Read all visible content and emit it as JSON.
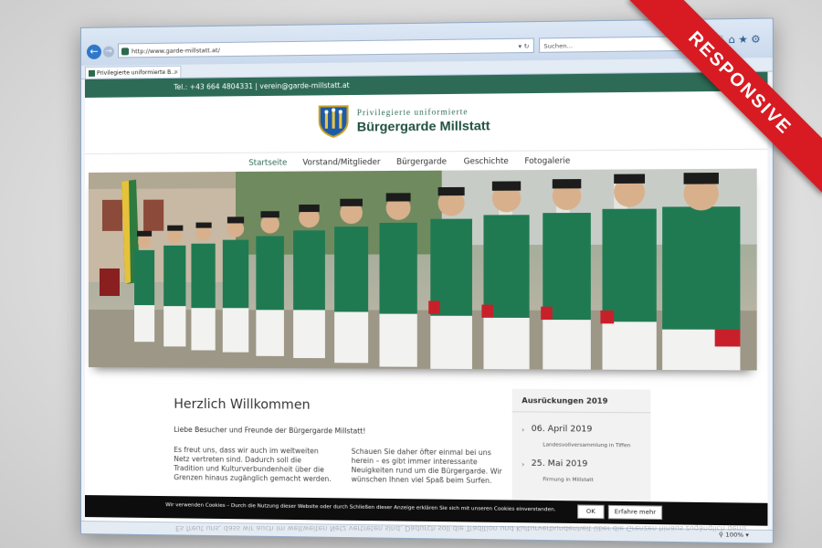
{
  "browser": {
    "url": "http://www.garde-millstatt.at/",
    "search_placeholder": "Suchen...",
    "tab_title": "Privilegierte uniformierte B...",
    "zoom": "100%"
  },
  "site": {
    "contact": "Tel.: +43 664 4804331 | verein@garde-millstatt.at",
    "logo_line1": "Privilegierte uniformierte",
    "logo_line2": "Bürgergarde Millstatt"
  },
  "menu": [
    {
      "label": "Startseite",
      "active": true
    },
    {
      "label": "Vorstand/Mitglieder"
    },
    {
      "label": "Bürgergarde"
    },
    {
      "label": "Geschichte"
    },
    {
      "label": "Fotogalerie"
    }
  ],
  "welcome": {
    "title": "Herzlich Willkommen",
    "intro": "Liebe Besucher und Freunde der Bürgergarde Millstatt!",
    "col1": "Es freut uns, dass wir auch im weltweiten Netz vertreten sind. Dadurch soll die Tradition und Kulturverbundenheit über die Grenzen hinaus zugänglich gemacht werden.",
    "col2": "Schauen Sie daher öfter einmal bei uns herein – es gibt immer interessante Neuigkeiten rund um die Bürgergarde. Wir wünschen Ihnen viel Spaß beim Surfen."
  },
  "sidebar": {
    "heading": "Ausrückungen 2019",
    "events": [
      {
        "date": "06. April 2019",
        "desc": "Landesvollversammlung in Tiffen"
      },
      {
        "date": "25. Mai 2019",
        "desc": "Firmung in Millstatt"
      }
    ]
  },
  "cookie": {
    "text": "Wir verwenden Cookies – Durch die Nutzung dieser Website oder durch Schließen dieser Anzeige erklären Sie sich mit unseren Cookies einverstanden.",
    "ok": "OK",
    "more": "Erfahre mehr"
  },
  "ribbon": "RESPONSIVE",
  "colors": {
    "brand_green": "#2d6b56",
    "ribbon_red": "#d81b23",
    "uniform_green": "#1f7a52"
  }
}
